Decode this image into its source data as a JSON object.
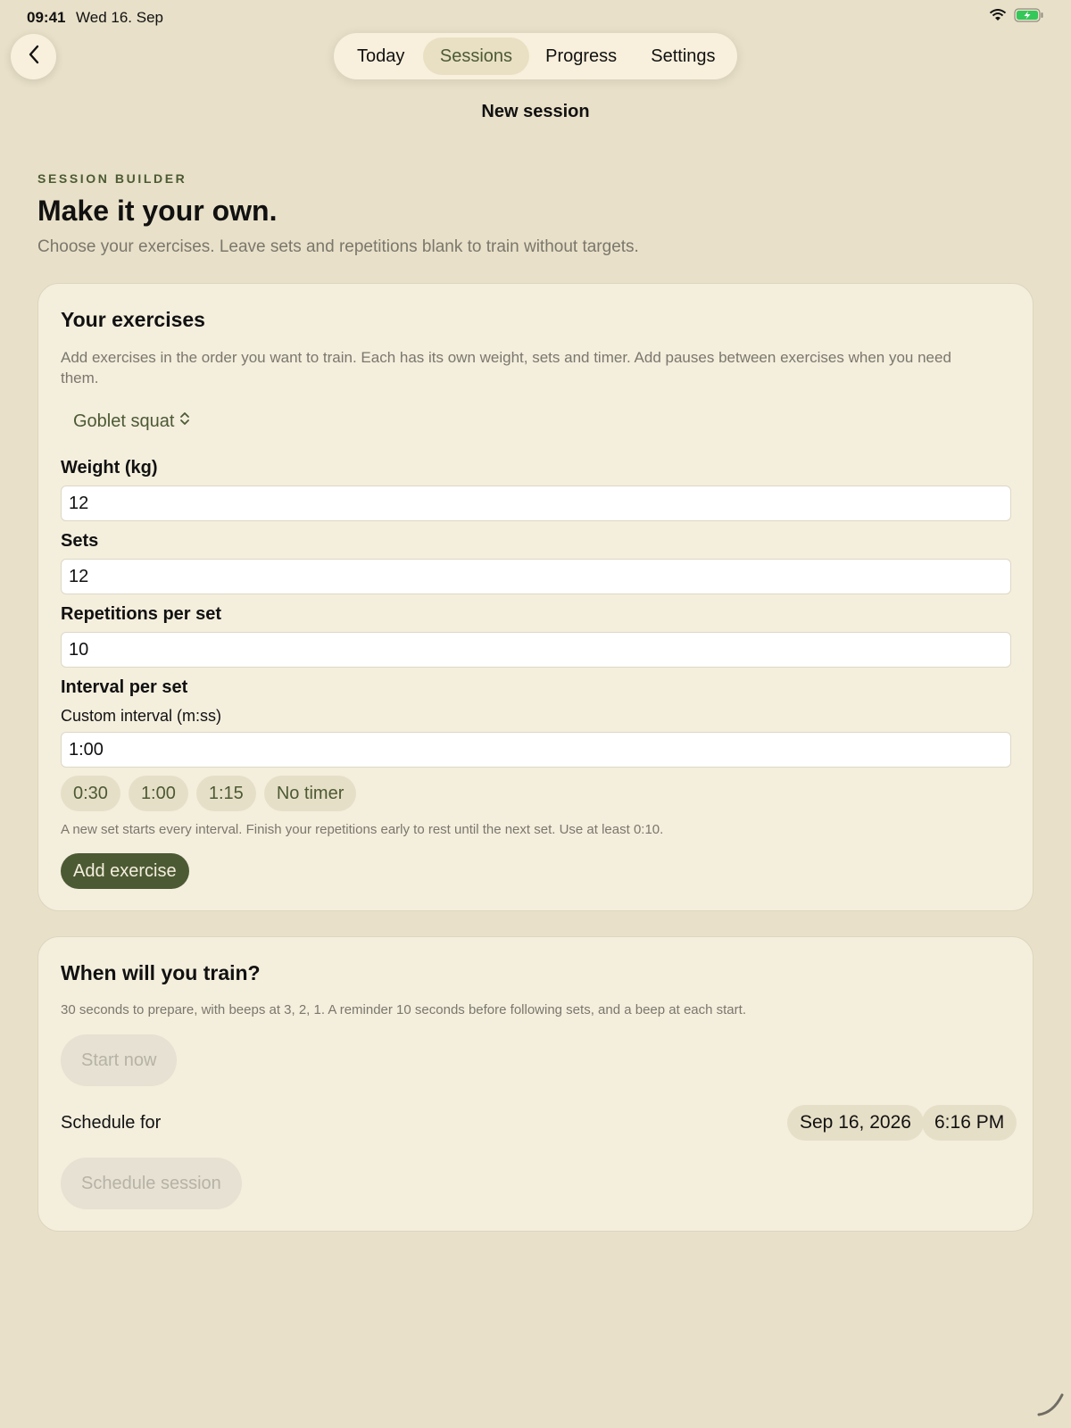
{
  "status_bar": {
    "time": "09:41",
    "date": "Wed 16. Sep",
    "battery_color": "#34c759"
  },
  "tabs": [
    {
      "label": "Today"
    },
    {
      "label": "Sessions",
      "selected": true
    },
    {
      "label": "Progress"
    },
    {
      "label": "Settings"
    }
  ],
  "nav": {
    "title": "New session"
  },
  "header": {
    "eyebrow": "SESSION BUILDER",
    "headline": "Make it your own.",
    "subtitle": "Choose your exercises. Leave sets and repetitions blank to train without targets."
  },
  "exercises_card": {
    "title": "Your exercises",
    "description": "Add exercises in the order you want to train. Each has its own weight, sets and timer. Add pauses between exercises when you need them.",
    "exercise_picker": "Goblet squat",
    "weight_label": "Weight (kg)",
    "weight_value": "12",
    "sets_label": "Sets",
    "sets_value": "12",
    "reps_label": "Repetitions per set",
    "reps_value": "10",
    "interval_label": "Interval per set",
    "custom_interval_label": "Custom interval (m:ss)",
    "custom_interval_value": "1:00",
    "interval_chips": [
      "0:30",
      "1:00",
      "1:15",
      "No timer"
    ],
    "hint": "A new set starts every interval. Finish your repetitions early to rest until the next set. Use at least 0:10.",
    "add_button": "Add exercise"
  },
  "schedule_card": {
    "title": "When will you train?",
    "description": "30 seconds to prepare, with beeps at 3, 2, 1. A reminder 10 seconds before following sets, and a beep at each start.",
    "start_button": "Start now",
    "schedule_label": "Schedule for",
    "date_value": "Sep 16, 2026",
    "time_value": "6:16 PM",
    "schedule_button": "Schedule session"
  },
  "colors": {
    "background": "#e8e0c8",
    "card": "#f4eedd",
    "accent": "#4c5a34",
    "muted_text": "#7a776c"
  }
}
